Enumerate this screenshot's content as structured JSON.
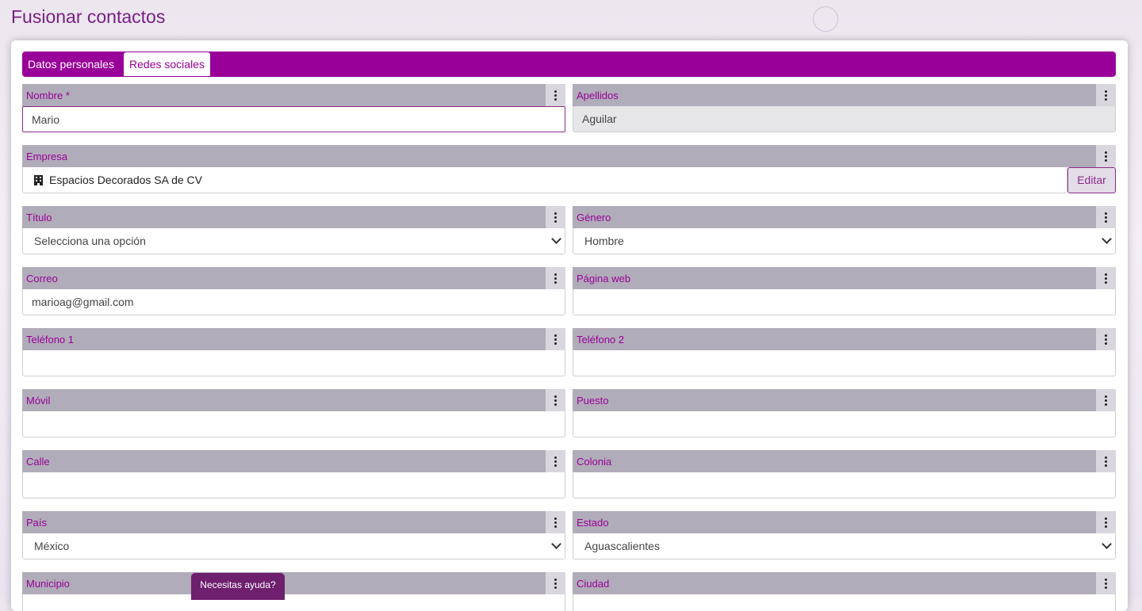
{
  "page": {
    "title": "Fusionar contactos"
  },
  "tabs": [
    {
      "label": "Datos personales"
    },
    {
      "label": "Redes sociales"
    }
  ],
  "fields": {
    "nombre": {
      "label": "Nombre *",
      "value": "Mario"
    },
    "apellidos": {
      "label": "Apellidos",
      "value": "Aguilar"
    },
    "empresa": {
      "label": "Empresa",
      "value": "Espacios Decorados SA de CV",
      "icon": "building-icon",
      "edit_label": "Editar"
    },
    "titulo": {
      "label": "Título",
      "value": "Selecciona una opción"
    },
    "genero": {
      "label": "Género",
      "value": "Hombre"
    },
    "correo": {
      "label": "Correo",
      "value": "marioag@gmail.com"
    },
    "pagina_web": {
      "label": "Página web",
      "value": ""
    },
    "telefono1": {
      "label": "Teléfono 1",
      "value": ""
    },
    "telefono2": {
      "label": "Teléfono 2",
      "value": ""
    },
    "movil": {
      "label": "Móvil",
      "value": ""
    },
    "puesto": {
      "label": "Puesto",
      "value": ""
    },
    "calle": {
      "label": "Calle",
      "value": ""
    },
    "colonia": {
      "label": "Colonia",
      "value": ""
    },
    "pais": {
      "label": "País",
      "value": "México"
    },
    "estado": {
      "label": "Estado",
      "value": "Aguascalientes"
    },
    "municipio": {
      "label": "Municipio",
      "value": ""
    },
    "ciudad": {
      "label": "Ciudad",
      "value": ""
    }
  },
  "help": {
    "label": "Necesitas ayuda?"
  },
  "colors": {
    "accent": "#990099",
    "label_bg": "#b1acb9",
    "help_bg": "#6e1f6e"
  }
}
